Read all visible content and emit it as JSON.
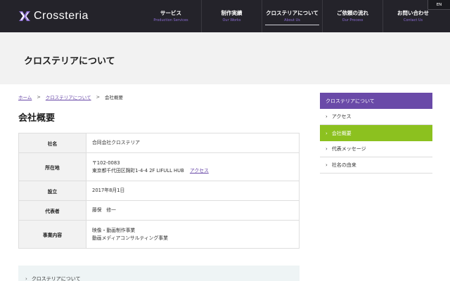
{
  "header": {
    "logo_text": "Crossteria",
    "lang_button": "EN",
    "nav": [
      {
        "jp": "サービス",
        "en": "Production Services"
      },
      {
        "jp": "制作実績",
        "en": "Our Works"
      },
      {
        "jp": "クロステリアについて",
        "en": "About Us"
      },
      {
        "jp": "ご依頼の流れ",
        "en": "Our Process"
      },
      {
        "jp": "お問い合わせ",
        "en": "Contact Us"
      }
    ],
    "active_nav_index": 2
  },
  "page_title": "クロステリアについて",
  "breadcrumb": {
    "home": "ホーム",
    "sep1": ">",
    "parent": "クロステリアについて",
    "sep2": ">",
    "current": "会社概要"
  },
  "section_title": "会社概要",
  "company_table": {
    "name_label": "社名",
    "name_value": "合同会社クロステリア",
    "address_label": "所在地",
    "address_postal": "〒102-0083",
    "address_line": "東京都千代田区麹町1-4-4 2F LIFULL HUB",
    "address_link": "アクセス",
    "founded_label": "設立",
    "founded_value": "2017年8月1日",
    "rep_label": "代表者",
    "rep_value": "藤保　修一",
    "business_label": "事業内容",
    "business_line1": "映像・動画制作事業",
    "business_line2": "動画メディアコンサルティング事業"
  },
  "bottom_menu": {
    "item_label": "クロステリアについて"
  },
  "sidebar": {
    "heading": "クロステリアについて",
    "items": [
      {
        "label": "アクセス"
      },
      {
        "label": "会社概要"
      },
      {
        "label": "代表メッセージ"
      },
      {
        "label": "社名の由来"
      }
    ],
    "active_index": 1
  },
  "colors": {
    "header_bg": "#24232a",
    "accent_purple": "#6a4aa8",
    "accent_green": "#8cc11f"
  }
}
